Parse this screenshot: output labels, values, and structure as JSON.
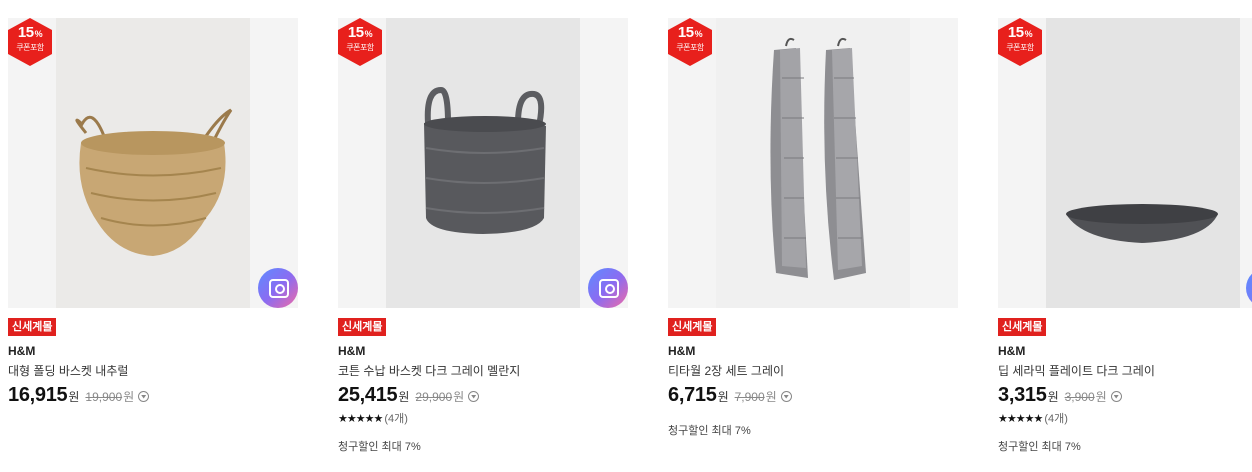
{
  "products": [
    {
      "badge_pct": "15",
      "badge_unit": "%",
      "badge_text": "쿠폰포함",
      "tag": "신세계몰",
      "brand": "H&M",
      "name": "대형 폴딩 바스켓 내추럴",
      "price": "16,915",
      "currency": "원",
      "original_price": "19,900",
      "rating_stars": "",
      "rating_count": "",
      "extra": "",
      "image": "straw-basket",
      "has_lens": true
    },
    {
      "badge_pct": "15",
      "badge_unit": "%",
      "badge_text": "쿠폰포함",
      "tag": "신세계몰",
      "brand": "H&M",
      "name": "코튼 수납 바스켓 다크 그레이 멜란지",
      "price": "25,415",
      "currency": "원",
      "original_price": "29,900",
      "rating_stars": "★★★★★",
      "rating_count": "(4개)",
      "extra": "청구할인 최대 7%",
      "image": "grey-basket",
      "has_lens": true
    },
    {
      "badge_pct": "15",
      "badge_unit": "%",
      "badge_text": "쿠폰포함",
      "tag": "신세계몰",
      "brand": "H&M",
      "name": "티타월 2장 세트 그레이",
      "price": "6,715",
      "currency": "원",
      "original_price": "7,900",
      "rating_stars": "",
      "rating_count": "",
      "extra": "청구할인 최대 7%",
      "image": "tea-towels",
      "has_lens": false
    },
    {
      "badge_pct": "15",
      "badge_unit": "%",
      "badge_text": "쿠폰포함",
      "tag": "신세계몰",
      "brand": "H&M",
      "name": "딥 세라믹 플레이트 다크 그레이",
      "price": "3,315",
      "currency": "원",
      "original_price": "3,900",
      "rating_stars": "★★★★★",
      "rating_count": "(4개)",
      "extra": "청구할인 최대 7%",
      "image": "ceramic-plate",
      "has_lens": false
    }
  ],
  "colors": {
    "badge": "#e8201c",
    "tag": "#e0211e"
  }
}
